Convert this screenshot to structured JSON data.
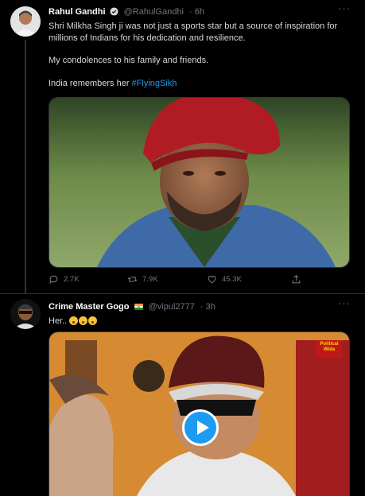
{
  "tweets": [
    {
      "author": "Rahul Gandhi",
      "verified": true,
      "handle": "@RahulGandhi",
      "time": "· 6h",
      "text_1": "Shri Milkha Singh ji was not just a sports star but a source of inspiration for millions of Indians for his dedication and resilience.",
      "text_2": "My condolences to his family and friends.",
      "text_3_prefix": "India remembers her ",
      "hashtag": "#FlyingSikh",
      "media": "photo",
      "replies": "2.7K",
      "retweets": "7.9K",
      "likes": "45.3K"
    },
    {
      "author": "Crime Master Gogo",
      "flag": "india-flag",
      "handle": "@vipul2777",
      "time": "· 3h",
      "text": "Her.. ",
      "emoji": [
        "flushed-face",
        "flushed-face",
        "flushed-face"
      ],
      "media": "video",
      "watermark": "Political Wida"
    }
  ],
  "more_icon": "···",
  "colors": {
    "background": "#000000",
    "accent": "#1d9bf0",
    "muted": "#6e767d",
    "divider": "#2f3336"
  }
}
